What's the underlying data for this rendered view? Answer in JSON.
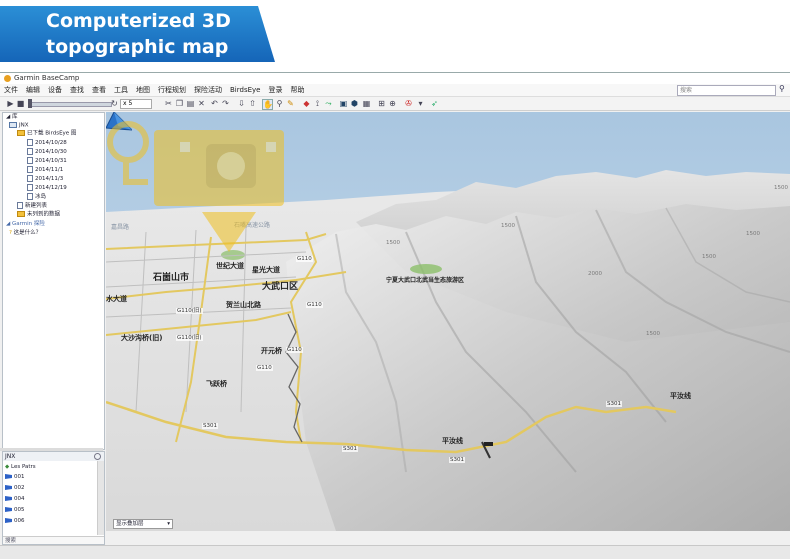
{
  "banner": {
    "line1": "Computerized 3D",
    "line2": "topographic map"
  },
  "app": {
    "title": "Garmin BaseCamp",
    "menu": [
      "文件",
      "编辑",
      "设备",
      "查找",
      "查看",
      "工具",
      "地图",
      "行程规划",
      "探险活动",
      "BirdsEye",
      "登录",
      "帮助"
    ],
    "search_placeholder": "搜索"
  },
  "toolbar": {
    "zoom_value": "x 5"
  },
  "library": {
    "root": "库",
    "jnx_item": "JNX",
    "folder": "已下载 BirdsEye 图",
    "dates": [
      "2014/10/28",
      "2014/10/30",
      "2014/10/31",
      "2014/11/1",
      "2014/11/3",
      "2014/12/19"
    ],
    "misc_item": "冰岛",
    "new_list": "新建列表",
    "unlisted": "未列到的数据",
    "garmin_header": "Garmin 探险",
    "help": "这是什么？"
  },
  "bottom": {
    "header": "JNX",
    "items": [
      "Les Patrs",
      "001",
      "002",
      "004",
      "005",
      "006"
    ],
    "search": "搜索"
  },
  "map": {
    "places": [
      "石崮山市",
      "大武口区",
      "世纪大道",
      "星光大道",
      "贺兰山北路",
      "开元桥",
      "飞跃桥",
      "大沙沟桥(旧)",
      "水大道",
      "宁夏大武口北武当生态旅游区",
      "平汝线",
      "平汝线"
    ],
    "faint_labels": [
      "嘉昌路",
      "石嘴高速公路"
    ],
    "roads": [
      "G110",
      "G110",
      "G110",
      "G110",
      "G110(旧)",
      "G110(旧)",
      "S301",
      "S301",
      "S301",
      "S301"
    ],
    "elevations": [
      "1500",
      "1500",
      "2000",
      "1500",
      "1500",
      "1500",
      "1500"
    ],
    "overlay_select": "显示叠加层"
  },
  "colors": {
    "banner": "#1e78c8",
    "road": "#e3c860",
    "sky": "#b9d2e6",
    "terrain": "#d6d6d6",
    "watermark": "#f0c020"
  }
}
